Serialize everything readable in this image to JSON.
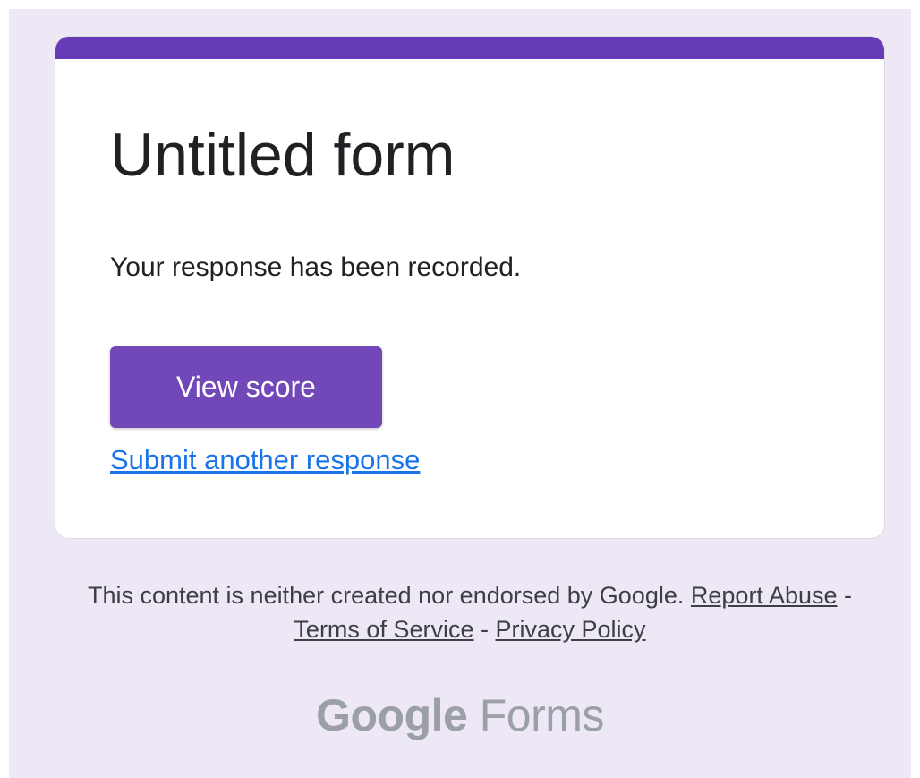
{
  "form": {
    "title": "Untitled form",
    "confirmation_message": "Your response has been recorded.",
    "view_score_label": "View score",
    "submit_another_label": "Submit another response"
  },
  "footer": {
    "disclaimer": "This content is neither created nor endorsed by Google.",
    "report_abuse_label": "Report Abuse",
    "separator": "-",
    "terms_label": "Terms of Service",
    "privacy_label": "Privacy Policy"
  },
  "brand": {
    "google": "Google",
    "product": "Forms"
  },
  "colors": {
    "page_background": "#ede7f6",
    "accent": "#673ab7",
    "button": "#7248b9",
    "link": "#1a73e8",
    "brand_text": "#9aa0a6"
  }
}
